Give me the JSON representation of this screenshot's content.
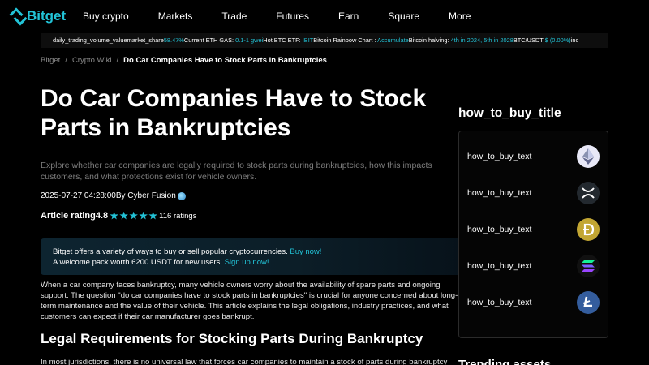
{
  "nav": {
    "brand": "Bitget",
    "items": [
      "Buy crypto",
      "Markets",
      "Trade",
      "Futures",
      "Earn",
      "Square",
      "More"
    ]
  },
  "ticker": {
    "items": [
      {
        "label": "daily_trading_volume_valuemarket_share",
        "value": "58.47%"
      },
      {
        "label": "Current ETH GAS: ",
        "value": "0.1-1 gwei"
      },
      {
        "label": "Hot BTC ETF: ",
        "value": "IBIT"
      },
      {
        "label": "Bitcoin Rainbow Chart : ",
        "value": "Accumulate"
      },
      {
        "label": "Bitcoin halving: ",
        "value": "4th in 2024, 5th in 2028"
      },
      {
        "label": "BTC/USDT ",
        "value": "$ (0.00%)"
      },
      {
        "label": "inc",
        "value": ""
      }
    ]
  },
  "breadcrumb": {
    "home": "Bitget",
    "section": "Crypto Wiki",
    "current": "Do Car Companies Have to Stock Parts in Bankruptcies"
  },
  "article": {
    "title": "Do Car Companies Have to Stock Parts in Bankruptcies",
    "description": "Explore whether car companies are legally required to stock parts during bankruptcies, how this impacts customers, and what protections exist for vehicle owners.",
    "timestamp": "2025-07-27 04:28:00",
    "author": "By Cyber Fusion",
    "rating_label": "Article rating",
    "rating_value": "4.8",
    "stars": 5,
    "rating_count": "116 ratings",
    "promo_line1": "Bitget offers a variety of ways to buy or sell popular cryptocurrencies.",
    "promo_link1": "Buy now!",
    "promo_line2": "A welcome pack worth 6200 USDT for new users!",
    "promo_link2": "Sign up now!",
    "body1": "When a car company faces bankruptcy, many vehicle owners worry about the availability of spare parts and ongoing support. The question \"do car companies have to stock parts in bankruptcies\" is crucial for anyone concerned about long-term maintenance and the value of their vehicle. This article explains the legal obligations, industry practices, and what customers can expect if their car manufacturer goes bankrupt.",
    "heading2": "Legal Requirements for Stocking Parts During Bankruptcy",
    "body2": "In most jurisdictions, there is no universal law that forces car companies to maintain a stock of parts during bankruptcy"
  },
  "sidebar": {
    "title": "how_to_buy_title",
    "coins": [
      {
        "text": "how_to_buy_text",
        "icon": "ethereum-icon",
        "color": "#e6e6f5"
      },
      {
        "text": "how_to_buy_text",
        "icon": "xrp-icon",
        "color": "#23292f"
      },
      {
        "text": "how_to_buy_text",
        "icon": "dogecoin-icon",
        "color": "#c2a633"
      },
      {
        "text": "how_to_buy_text",
        "icon": "solana-icon",
        "color": "#111111"
      },
      {
        "text": "how_to_buy_text",
        "icon": "litecoin-icon",
        "color": "#345d9d"
      }
    ],
    "bottom_title": "Trending assets"
  },
  "colors": {
    "accent": "#22c3d7",
    "background": "#000000"
  }
}
